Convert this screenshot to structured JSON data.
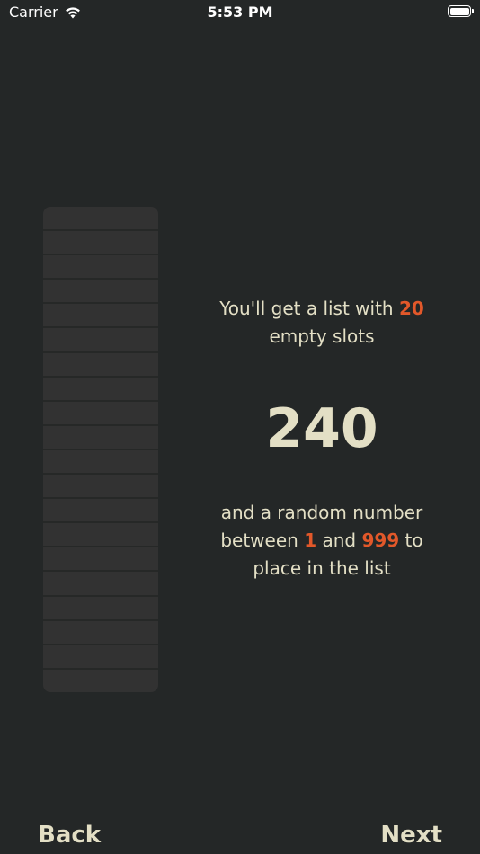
{
  "status_bar": {
    "carrier": "Carrier",
    "time": "5:53 PM",
    "wifi_icon": "wifi-icon",
    "battery_icon": "battery-icon"
  },
  "slot_list": {
    "slot_count": 20
  },
  "intro": {
    "line1_prefix": "You'll get a list with ",
    "slot_count_value": "20",
    "line1_suffix": " empty slots"
  },
  "random_number": "240",
  "description": {
    "part1": "and a random number between ",
    "min_value": "1",
    "part2": " and ",
    "max_value": "999",
    "part3": " to place in the list"
  },
  "nav": {
    "back_label": "Back",
    "next_label": "Next"
  },
  "colors": {
    "background": "#242727",
    "text": "#e3dfc5",
    "accent": "#e2582a",
    "slot": "#323232"
  }
}
